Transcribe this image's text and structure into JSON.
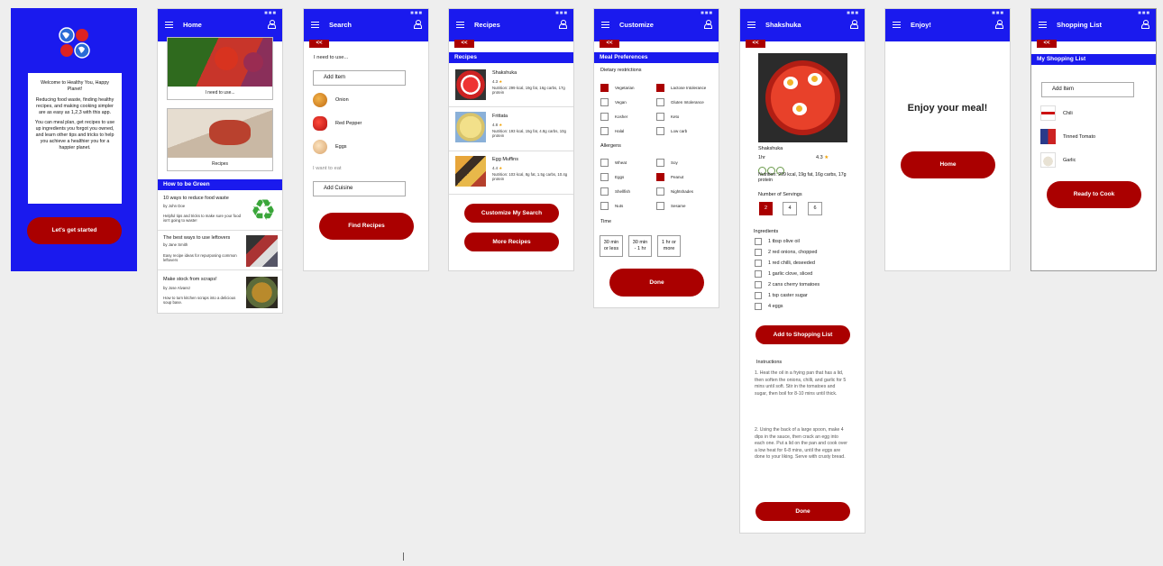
{
  "welcome": {
    "text1": "Welcome to Healthy You, Happy Planet!",
    "text2": "Reducing food waste, finding healthy recipes, and making cooking simpler are as easy as 1,2,3 with this app.",
    "text3": "You can meal plan, get recipes to use up ingredients you forgot you owned, and learn other tips and tricks to help you achieve a healthier you for a happier planet.",
    "cta": "Let's get started"
  },
  "home": {
    "title": "Home",
    "card1": "I need to use...",
    "card2": "Recipes",
    "section": "How to be Green",
    "articles": [
      {
        "title": "10 ways to reduce food waste",
        "author": "by John Doe",
        "desc": "Helpful tips and tricks to make sure your food isn't going to waste!"
      },
      {
        "title": "The best ways to use leftovers",
        "author": "by Jane Smith",
        "desc": "Easy recipe ideas for repurposing common leftovers"
      },
      {
        "title": "Make stock from scraps!",
        "author": "by Jose Alvarez",
        "desc": "How to turn kitchen scraps into a delicious soup base."
      }
    ]
  },
  "search": {
    "title": "Search",
    "back": "<<",
    "need_label": "I need to use...",
    "add_item": "Add Item",
    "items": [
      "Onion",
      "Red Pepper",
      "Eggs"
    ],
    "want_label": "I want to eat",
    "add_cuisine": "Add Cuisine",
    "find": "Find Recipes"
  },
  "recipes": {
    "title": "Recipes",
    "back": "<<",
    "band": "Recipes",
    "list": [
      {
        "name": "Shakshuka",
        "rating": "4.3",
        "star": "★",
        "nutrition": "Nutrition: 299 kcal, 19g fat, 16g carbs, 17g protein"
      },
      {
        "name": "Frittata",
        "rating": "4.8",
        "star": "★",
        "nutrition": "Nutrition: 193 kcal, 15g fat, 4.8g carbs, 10g protein"
      },
      {
        "name": "Egg Muffins",
        "rating": "4.4",
        "star": "★",
        "nutrition": "Nutrition: 103 kcal, 8g fat, 1.5g carbs, 10.4g protein"
      }
    ],
    "customize": "Customize My Search",
    "more": "More Recipes"
  },
  "customize": {
    "title": "Customize",
    "back": "<<",
    "band": "Meal Preferences",
    "dietary": "Dietary restrictions",
    "diet": [
      {
        "label": "Vegetarian",
        "on": true
      },
      {
        "label": "Lactose Intolerance",
        "on": true
      },
      {
        "label": "Vegan",
        "on": false
      },
      {
        "label": "Gluten Intolerance",
        "on": false
      },
      {
        "label": "Kosher",
        "on": false
      },
      {
        "label": "Keto",
        "on": false
      },
      {
        "label": "Halal",
        "on": false
      },
      {
        "label": "Low carb",
        "on": false
      }
    ],
    "allergens": "Allergens",
    "allergy": [
      {
        "label": "Wheat",
        "on": false
      },
      {
        "label": "Soy",
        "on": false
      },
      {
        "label": "Eggs",
        "on": false
      },
      {
        "label": "Peanut",
        "on": true
      },
      {
        "label": "Shellfish",
        "on": false
      },
      {
        "label": "Nightshades",
        "on": false
      },
      {
        "label": "Nuts",
        "on": false
      },
      {
        "label": "Sesame",
        "on": false
      }
    ],
    "time": "Time",
    "times": [
      [
        "30 min",
        "or less"
      ],
      [
        "30 min",
        "- 1 hr"
      ],
      [
        "1 hr or",
        "more"
      ]
    ],
    "done": "Done"
  },
  "detail": {
    "title": "Shakshuka",
    "back": "<<",
    "name": "Shakshuka",
    "time": "1hr",
    "rating": "4.3",
    "star": "★",
    "nutrition": "Nutrition: 299 kcal, 19g fat, 16g carbs, 17g protein",
    "servings_label": "Number of Servings",
    "servings": [
      "2",
      "4",
      "6"
    ],
    "ingredients_label": "Ingredients",
    "ingredients": [
      "1 tbsp olive oil",
      "2 red onions, chopped",
      "1 red chilli, deseeded",
      "1 garlic clove, sliced",
      "2 cans cherry tomatoes",
      "1 tsp caster sugar",
      "4 eggs"
    ],
    "add": "Add to Shopping List",
    "instructions_label": "Instructions",
    "step1": "1.    Heat the oil in a frying pan that has a lid, then soften the onions, chilli, and garlic for 5 mins until soft. Stir in the tomatoes and sugar, then boil for 8-10 mins until thick.",
    "step2": "2.    Using the back of a large spoon, make 4 dips in the sauce, then crack an egg into each one. Put a lid on the pan and cook over a low heat for 6-8 mins, until the eggs are done to your liking. Serve with crusty bread.",
    "done": "Done"
  },
  "enjoy": {
    "title": "Enjoy!",
    "message": "Enjoy your meal!",
    "home": "Home"
  },
  "shopping": {
    "title": "Shopping List",
    "back": "<<",
    "band": "My Shopping List",
    "add_item": "Add Item",
    "items": [
      "Chili",
      "Tinned Tomato",
      "Garlic"
    ],
    "ready": "Ready to Cook"
  },
  "colors": {
    "blue": "#1a1aee",
    "red": "#aa0000"
  }
}
